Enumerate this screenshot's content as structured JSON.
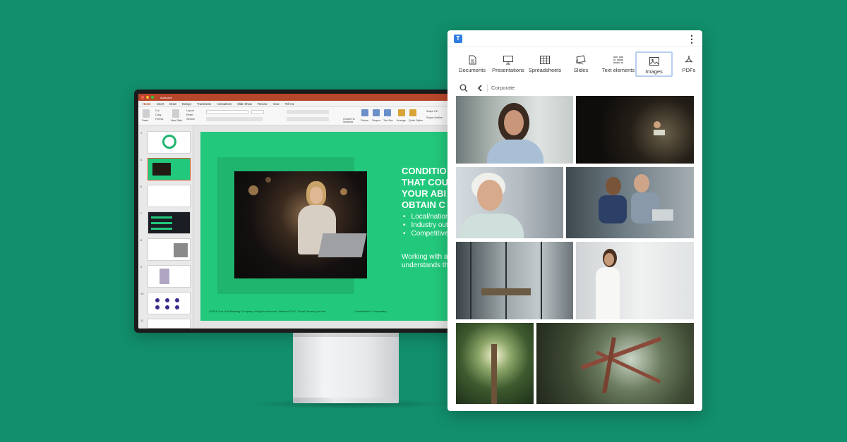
{
  "ppt": {
    "window_title": "Autosave",
    "tabs": [
      "Home",
      "Insert",
      "Draw",
      "Design",
      "Transitions",
      "Animations",
      "Slide Show",
      "Review",
      "View",
      "Tell me"
    ],
    "ribbon": {
      "paste": "Paste",
      "cut": "Cut",
      "copy": "Copy",
      "format": "Format",
      "new_slide": "New Slide",
      "layout": "Layout",
      "reset": "Reset",
      "section": "Section",
      "picture": "Picture",
      "shapes": "Shapes",
      "text_box": "Text Box",
      "arrange": "Arrange",
      "quick_styles": "Quick Styles",
      "shape_fill": "Shape Fill",
      "shape_outline": "Shape Outline",
      "convert_smartart": "Convert to SmartArt"
    },
    "thumb_numbers": [
      "4",
      "5",
      "6",
      "7",
      "8",
      "9",
      "10",
      "11"
    ],
    "slide": {
      "title": "CONDITIO\nTHAT COU\nYOUR ABI\nOBTAIN C",
      "bullets": [
        "Local/nationa",
        "Industry outl",
        "Competitive"
      ],
      "para": "Working with a l\nunderstands the",
      "footer": "©2021 Live Oak Banking Company. All rights reserved. Member FDIC. Equal Housing Lender.",
      "footer2": "Confidential & Proprietary"
    },
    "colors": {
      "accent": "#b7472a",
      "slide_bg": "#22c97c"
    }
  },
  "panel": {
    "logo": "T",
    "menu_icon": "kebab-icon",
    "categories": [
      {
        "label": "Documents",
        "icon": "document-icon"
      },
      {
        "label": "Presentations",
        "icon": "presentation-icon"
      },
      {
        "label": "Spreadsheets",
        "icon": "spreadsheet-icon"
      },
      {
        "label": "Slides",
        "icon": "slides-icon"
      },
      {
        "label": "Text elements",
        "icon": "text-elements-icon"
      },
      {
        "label": "Images",
        "icon": "image-icon",
        "active": true
      },
      {
        "label": "PDFs",
        "icon": "pdf-icon"
      }
    ],
    "breadcrumb": "Corporate",
    "colors": {
      "active_border": "#b8cff0",
      "logo": "#2f7de1"
    }
  }
}
